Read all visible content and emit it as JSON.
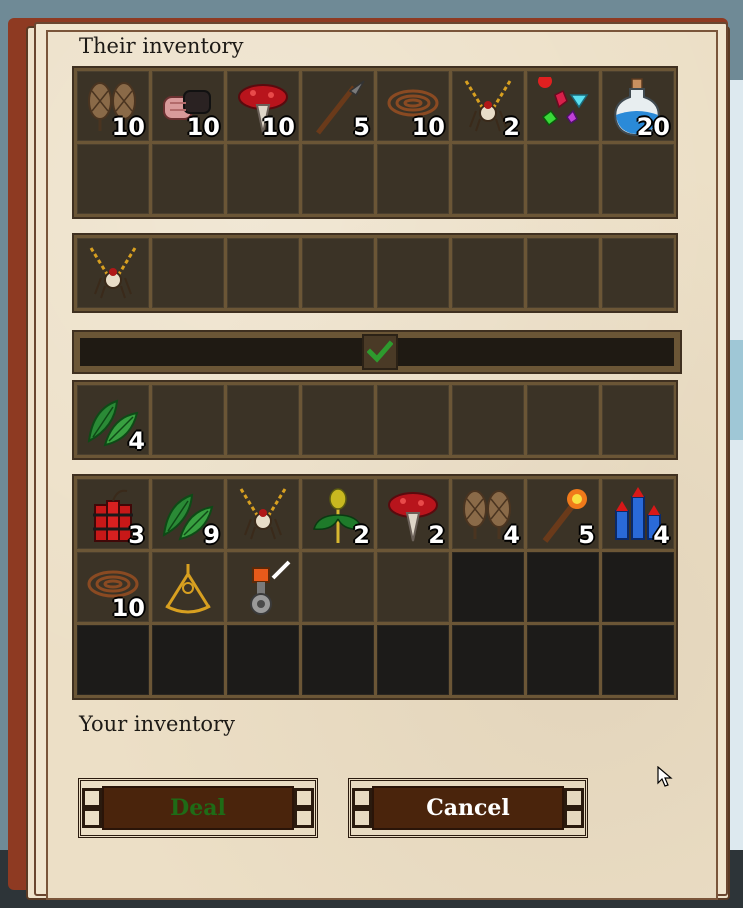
{
  "their_inventory": {
    "title": "Their inventory",
    "slots": [
      {
        "icon": "snowshoes-icon",
        "count": "10"
      },
      {
        "icon": "meat-icon",
        "count": "10"
      },
      {
        "icon": "mushroom-icon",
        "count": "10"
      },
      {
        "icon": "spear-icon",
        "count": "5"
      },
      {
        "icon": "rope-icon",
        "count": "10"
      },
      {
        "icon": "amulet-icon",
        "count": "2"
      },
      {
        "icon": "gems-icon",
        "count": ""
      },
      {
        "icon": "potion-icon",
        "count": "20"
      }
    ]
  },
  "their_offer": {
    "slots": [
      {
        "icon": "amulet-icon",
        "count": ""
      }
    ]
  },
  "confirm": {
    "icon": "checkmark-icon",
    "accent": "#2e9a2e"
  },
  "your_offer": {
    "slots": [
      {
        "icon": "herb-leaves-icon",
        "count": "4"
      }
    ]
  },
  "your_inventory": {
    "title": "Your inventory",
    "slots": [
      {
        "icon": "dynamite-icon",
        "count": "3"
      },
      {
        "icon": "herb-leaves-icon",
        "count": "9"
      },
      {
        "icon": "amulet-icon",
        "count": ""
      },
      {
        "icon": "herb-sprout-icon",
        "count": "2"
      },
      {
        "icon": "mushroom-icon",
        "count": "2"
      },
      {
        "icon": "snowshoes-icon",
        "count": "4"
      },
      {
        "icon": "torch-icon",
        "count": "5"
      },
      {
        "icon": "fireworks-icon",
        "count": "4"
      },
      {
        "icon": "rope-icon",
        "count": "10"
      },
      {
        "icon": "sextant-icon",
        "count": ""
      },
      {
        "icon": "lantern-icon",
        "count": ""
      }
    ]
  },
  "buttons": {
    "deal": {
      "label": "Deal",
      "color": "#1f6b16"
    },
    "cancel": {
      "label": "Cancel",
      "color": "#ffffff"
    }
  }
}
